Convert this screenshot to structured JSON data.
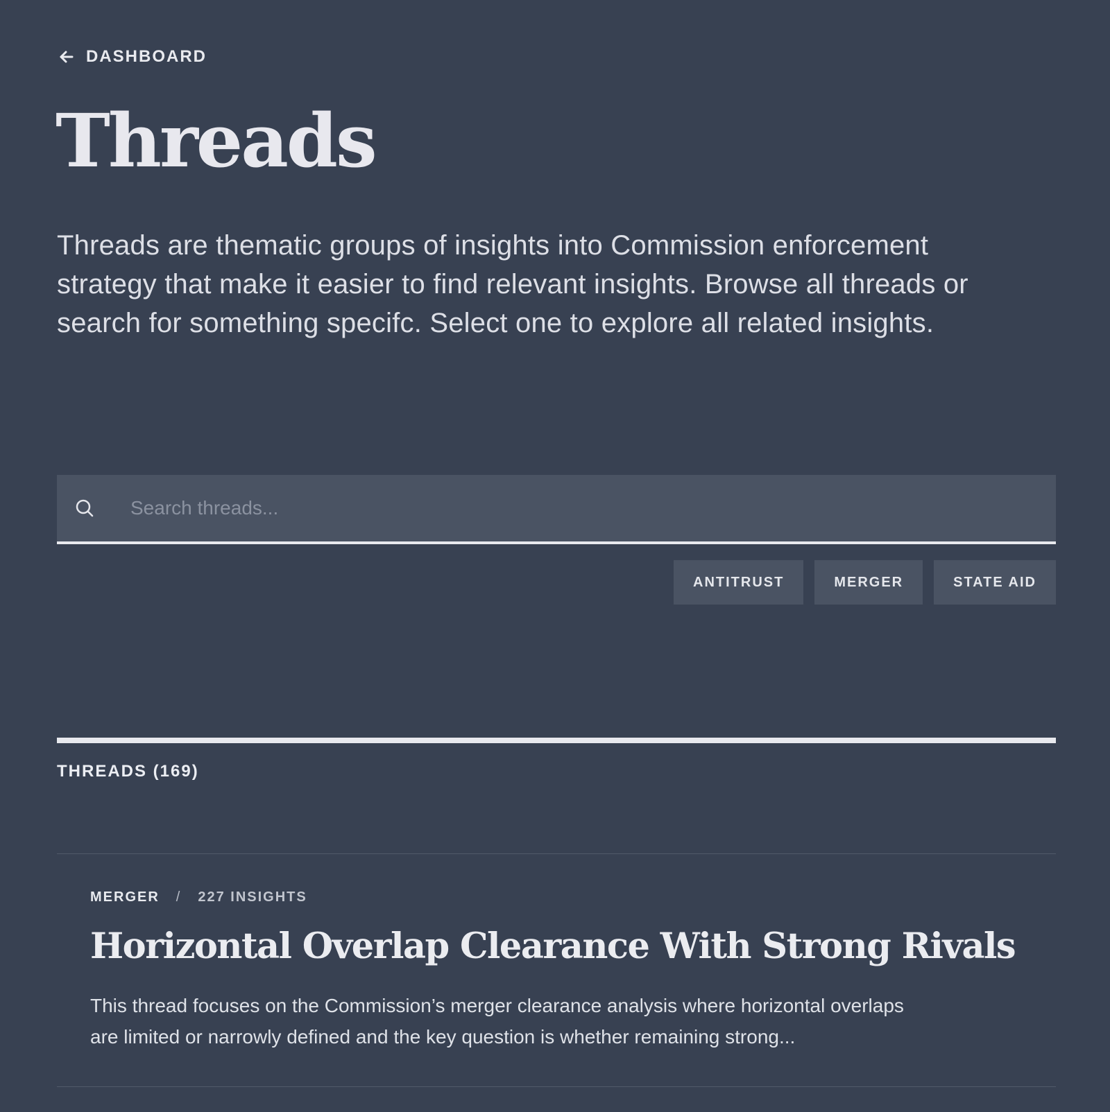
{
  "nav": {
    "back_label": "DASHBOARD"
  },
  "page": {
    "title": "Threads",
    "intro": "Threads are thematic groups of insights into Commission enforcement strategy that make it easier to find relevant insights. Browse all threads or search for something specifc. Select one to explore all related insights."
  },
  "search": {
    "placeholder": "Search threads..."
  },
  "filters": [
    {
      "label": "ANTITRUST"
    },
    {
      "label": "MERGER"
    },
    {
      "label": "STATE AID"
    }
  ],
  "threads_section": {
    "label": "THREADS (169)"
  },
  "threads": [
    {
      "category": "MERGER",
      "separator": "/",
      "insights": "227 INSIGHTS",
      "title": "Horizontal Overlap Clearance With Strong Rivals",
      "description": "This thread focuses on the Commission’s merger clearance analysis where horizontal overlaps are limited or narrowly defined and the key question is whether remaining strong..."
    }
  ],
  "colors": {
    "background": "#384152",
    "surface": "#4a5363",
    "text": "#e8e9ee",
    "muted": "#8b92a0"
  },
  "icons": {
    "back": "arrow-left-icon",
    "search": "search-icon"
  }
}
